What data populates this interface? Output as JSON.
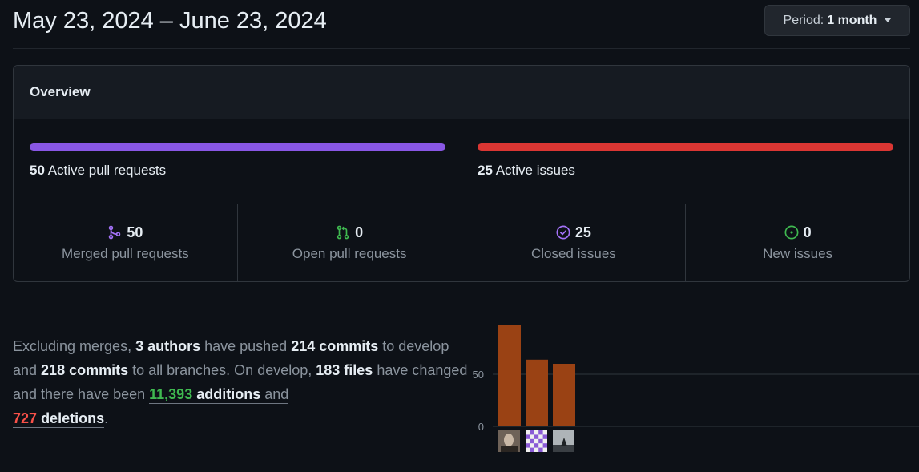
{
  "header": {
    "date_range": "May 23, 2024 – June 23, 2024",
    "period_label": "Period:",
    "period_value": "1 month"
  },
  "overview": {
    "title": "Overview",
    "pull_requests_bar": {
      "count": "50",
      "label": "Active pull requests",
      "fill_fraction": 1.0,
      "color": "#8957e5"
    },
    "issues_bar": {
      "count": "25",
      "label": "Active issues",
      "fill_fraction": 1.0,
      "color": "#da3633"
    },
    "stats": [
      {
        "icon": "merge-icon",
        "value": "50",
        "label": "Merged pull requests",
        "color": "#a371f7"
      },
      {
        "icon": "pull-request-icon",
        "value": "0",
        "label": "Open pull requests",
        "color": "#3fb950"
      },
      {
        "icon": "check-circle-icon",
        "value": "25",
        "label": "Closed issues",
        "color": "#a371f7"
      },
      {
        "icon": "issue-open-icon",
        "value": "0",
        "label": "New issues",
        "color": "#3fb950"
      }
    ]
  },
  "summary": {
    "t1": "Excluding merges, ",
    "authors": "3 authors",
    "t2": " have pushed ",
    "commits_branch": "214 commits",
    "t3": " to develop and ",
    "commits_all": "218 commits",
    "t4": " to all branches. On develop, ",
    "files": "183 files",
    "t5": " have changed and there have been ",
    "additions_num": "11,393",
    "additions_word": "additions",
    "t6": " and",
    "deletions_num": "727",
    "deletions_word": "deletions",
    "t7": "."
  },
  "chart_data": {
    "type": "bar",
    "categories": [
      "author-1",
      "author-2",
      "author-3"
    ],
    "values": [
      97,
      64,
      60
    ],
    "ylim": [
      0,
      100
    ],
    "yticks": [
      "50",
      "0"
    ],
    "ytick_values": [
      50,
      0
    ],
    "bar_color": "#9a4214",
    "grid": true,
    "xlabel": "",
    "ylabel": ""
  },
  "colors": {
    "background": "#0d1117",
    "border": "#30363d",
    "muted_text": "#8b949e",
    "accent_purple": "#8957e5",
    "accent_red": "#da3633",
    "accent_green": "#3fb950"
  }
}
